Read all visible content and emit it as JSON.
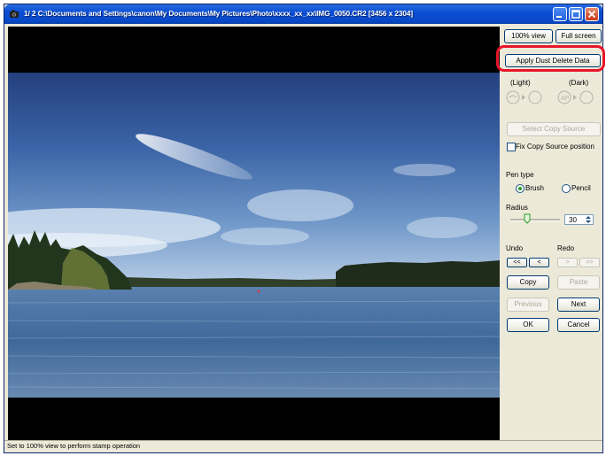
{
  "window": {
    "title": "1/ 2 C:\\Documents and Settings\\canon\\My Documents\\My Pictures\\Photo\\xxxx_xx_xx\\IMG_0050.CR2 [3456 x 2304]"
  },
  "panel": {
    "view_100": "100% view",
    "full_screen": "Full screen",
    "apply_dust": "Apply Dust Delete Data",
    "light_label": "(Light)",
    "dark_label": "(Dark)",
    "select_copy_source": "Select Copy Source",
    "fix_copy_source": "Fix Copy Source position",
    "pen_type_label": "Pen type",
    "brush_label": "Brush",
    "pencil_label": "Pencil",
    "pen_type_selected": "Brush",
    "radius_label": "Radius",
    "radius_value": "30",
    "undo_label": "Undo",
    "redo_label": "Redo",
    "undo_all": "<<",
    "undo_one": "<",
    "redo_one": ">",
    "redo_all": ">>",
    "copy": "Copy",
    "paste": "Paste",
    "previous": "Previous",
    "next": "Next",
    "ok": "OK",
    "cancel": "Cancel"
  },
  "status": {
    "text": "Set to 100% view to perform stamp operation"
  },
  "colors": {
    "highlight": "#e8162a",
    "titlebar": "#0a4fd4"
  }
}
